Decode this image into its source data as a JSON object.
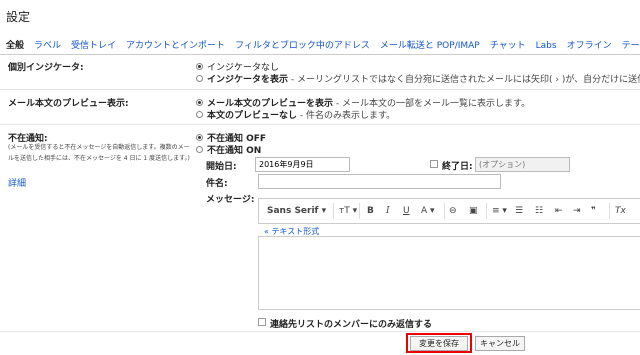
{
  "page": {
    "title": "設定"
  },
  "tabs": [
    {
      "label": "全般",
      "active": true
    },
    {
      "label": "ラベル"
    },
    {
      "label": "受信トレイ"
    },
    {
      "label": "アカウントとインポート"
    },
    {
      "label": "フィルタとブロック中のアドレス"
    },
    {
      "label": "メール転送と POP/IMAP"
    },
    {
      "label": "チャット"
    },
    {
      "label": "Labs"
    },
    {
      "label": "オフライン"
    },
    {
      "label": "テーマ"
    }
  ],
  "indicator": {
    "label": "個別インジケータ:",
    "opt1": "インジケータなし",
    "opt2_bold": "インジケータを表示",
    "opt2_desc": " - メーリングリストではなく自分宛に送信されたメールには矢印( › )が、自分だけに送信"
  },
  "preview": {
    "label": "メール本文のプレビュー表示:",
    "opt1_bold": "メール本文のプレビューを表示",
    "opt1_desc": " - メール本文の一部をメール一覧に表示します。",
    "opt2_bold": "本文のプレビューなし",
    "opt2_desc": " - 件名のみ表示します。"
  },
  "vacation": {
    "label": "不在通知:",
    "note": "(メールを受信すると不在メッセージを自動返信します。複数のメールを送信した相手には、不在メッセージを 4 日に 1 度送信します。)",
    "details_link": "詳細",
    "off_label": "不在通知 OFF",
    "on_label": "不在通知 ON",
    "start_label": "開始日:",
    "start_value": "2016年9月9日",
    "end_label": "終了日:",
    "end_placeholder": "(オプション)",
    "subject_label": "件名:",
    "message_label": "メッセージ:",
    "plain_text_link": "« テキスト形式",
    "contacts_only": "連絡先リストのメンバーにのみ返信する"
  },
  "toolbar": {
    "font": "Sans Serif",
    "font_arrow": "▾",
    "size": "тT ▾",
    "bold": "B",
    "italic": "I",
    "underline": "U",
    "color": "A ▾",
    "link": "⊖",
    "image": "▣",
    "align": "≡ ▾",
    "numbered": "☰",
    "bulleted": "☷",
    "indent_less": "⇤",
    "indent_more": "⇥",
    "quote": "❞",
    "clear": "Tx"
  },
  "buttons": {
    "save": "変更を保存",
    "cancel": "キャンセル"
  },
  "colors": {
    "link": "#1155cc",
    "highlight": "#ee0000"
  }
}
